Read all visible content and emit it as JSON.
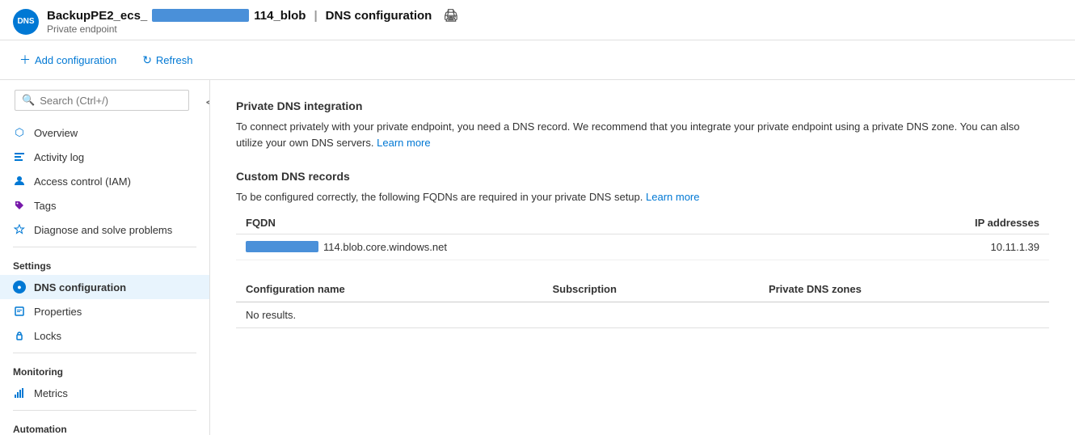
{
  "header": {
    "avatar_text": "DNS",
    "title_prefix": "BackupPE2_ecs_",
    "title_suffix": "114_blob",
    "title_section": "DNS configuration",
    "subtitle": "Private endpoint"
  },
  "toolbar": {
    "add_label": "Add configuration",
    "refresh_label": "Refresh"
  },
  "sidebar": {
    "search_placeholder": "Search (Ctrl+/)",
    "nav_items": [
      {
        "id": "overview",
        "label": "Overview",
        "icon": "⬡"
      },
      {
        "id": "activity-log",
        "label": "Activity log",
        "icon": "≡"
      },
      {
        "id": "access-control",
        "label": "Access control (IAM)",
        "icon": "👤"
      },
      {
        "id": "tags",
        "label": "Tags",
        "icon": "🏷"
      },
      {
        "id": "diagnose",
        "label": "Diagnose and solve problems",
        "icon": "🔧"
      }
    ],
    "settings_label": "Settings",
    "settings_items": [
      {
        "id": "dns-configuration",
        "label": "DNS configuration",
        "active": true
      },
      {
        "id": "properties",
        "label": "Properties"
      },
      {
        "id": "locks",
        "label": "Locks"
      }
    ],
    "monitoring_label": "Monitoring",
    "monitoring_items": [
      {
        "id": "metrics",
        "label": "Metrics"
      }
    ],
    "automation_label": "Automation"
  },
  "content": {
    "private_dns_title": "Private DNS integration",
    "private_dns_desc": "To connect privately with your private endpoint, you need a DNS record. We recommend that you integrate your private endpoint using a private DNS zone. You can also utilize your own DNS servers.",
    "private_dns_learn_more": "Learn more",
    "custom_dns_title": "Custom DNS records",
    "custom_dns_desc": "To be configured correctly, the following FQDNs are required in your private DNS setup.",
    "custom_dns_learn_more": "Learn more",
    "fqdn_col": "FQDN",
    "ip_col": "IP addresses",
    "fqdn_value": "114.blob.core.windows.net",
    "ip_value": "10.11.1.39",
    "config_name_col": "Configuration name",
    "subscription_col": "Subscription",
    "private_dns_col": "Private DNS zones",
    "no_results": "No results."
  }
}
